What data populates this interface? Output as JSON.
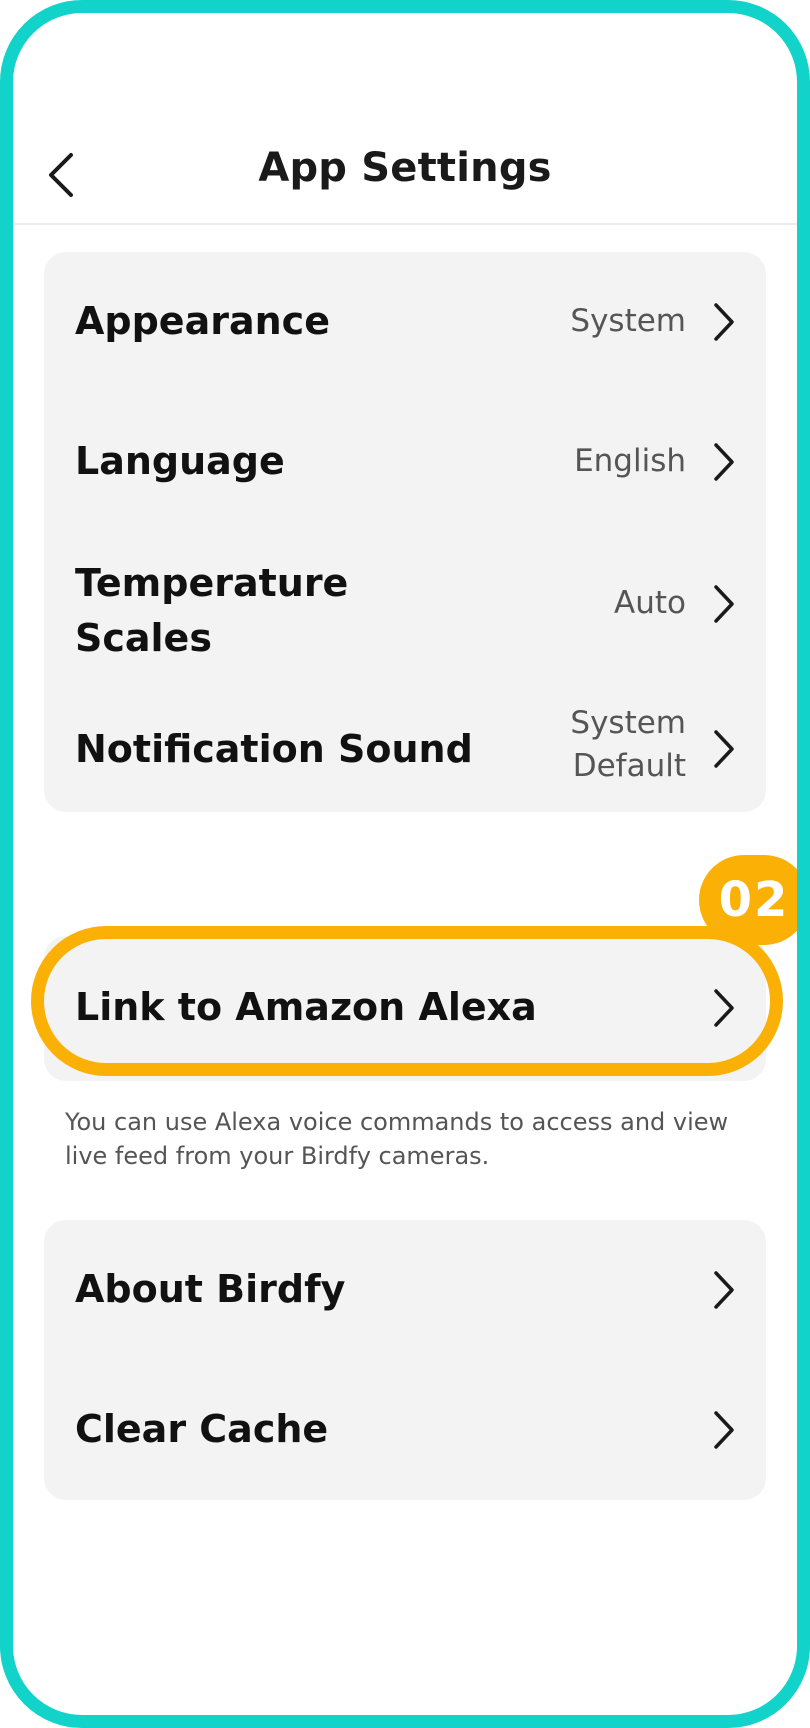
{
  "header": {
    "title": "App Settings",
    "back_icon": "chevron-left-icon"
  },
  "settings": {
    "appearance": {
      "label": "Appearance",
      "value": "System"
    },
    "language": {
      "label": "Language",
      "value": "English"
    },
    "temperature_scales": {
      "label": "Temperature\nScales",
      "value": "Auto"
    },
    "notification_sound": {
      "label": "Notification Sound",
      "value": "System\nDefault"
    }
  },
  "alexa": {
    "label": "Link to Amazon Alexa",
    "helper_text": "You can use Alexa voice commands to access and view live feed from your Birdfy cameras."
  },
  "more": {
    "about": {
      "label": "About Birdfy"
    },
    "clear_cache": {
      "label": "Clear Cache"
    }
  },
  "annotation": {
    "step_badge": "02",
    "highlight_color": "#fbb005"
  },
  "colors": {
    "frame": "#12d3c9",
    "card_background": "#f3f3f3",
    "highlight": "#fbb005"
  },
  "icons": {
    "row_chevron": "chevron-right-icon"
  }
}
